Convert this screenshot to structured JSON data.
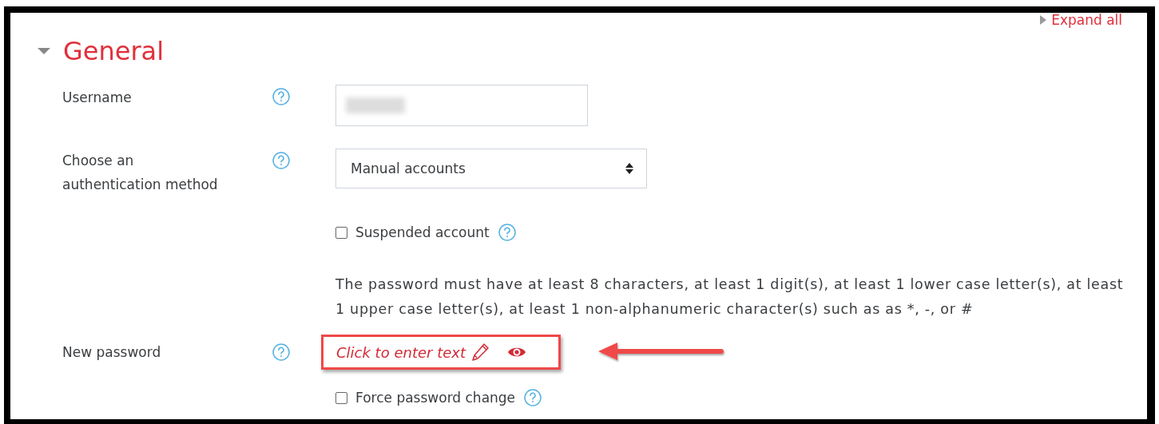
{
  "expand_all": "Expand all",
  "section": {
    "title": "General",
    "expanded": true
  },
  "rows": [
    {
      "kind": "text",
      "label": "Username",
      "help": true
    },
    {
      "kind": "select",
      "label": "Choose an authentication method",
      "help": true,
      "value": "Manual accounts"
    },
    {
      "kind": "checkbox",
      "label": "Suspended account",
      "checked": false,
      "help": true
    },
    {
      "kind": "note",
      "text": "The password must have at least 8 characters, at least 1 digit(s), at least 1 lower case letter(s), at least 1 upper case letter(s), at least 1 non-alphanumeric character(s) such as as *, -, or #"
    },
    {
      "kind": "password",
      "label": "New password",
      "help": true,
      "prompt": "Click to enter text",
      "highlighted": true
    },
    {
      "kind": "checkbox",
      "label": "Force password change",
      "checked": false,
      "help": true
    }
  ]
}
